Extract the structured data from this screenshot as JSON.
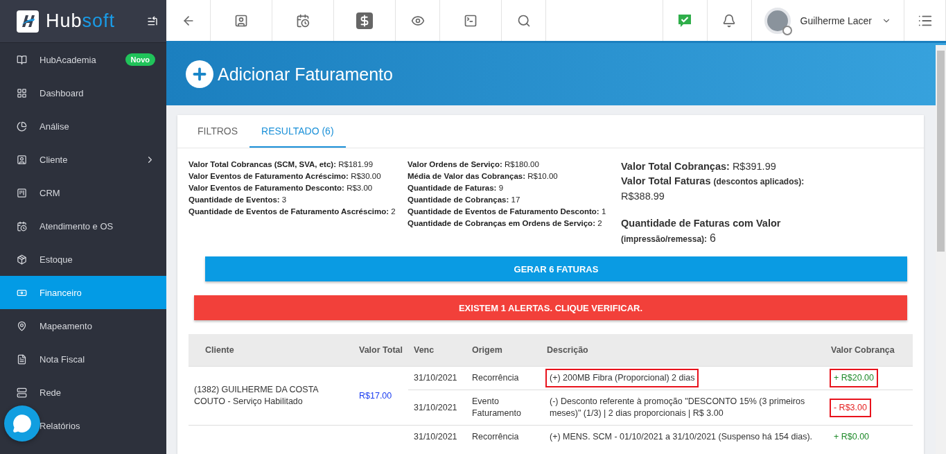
{
  "brand": {
    "name_part_1": "Hub",
    "name_part_2": "soft"
  },
  "sidebar": {
    "items": [
      {
        "label": "HubAcademia",
        "badge": "Novo",
        "selected": false
      },
      {
        "label": "Dashboard",
        "selected": false
      },
      {
        "label": "Análise",
        "selected": false
      },
      {
        "label": "Cliente",
        "selected": false,
        "has_submenu": true
      },
      {
        "label": "CRM",
        "selected": false
      },
      {
        "label": "Atendimento e OS",
        "selected": false
      },
      {
        "label": "Estoque",
        "selected": false
      },
      {
        "label": "Financeiro",
        "selected": true
      },
      {
        "label": "Mapeamento",
        "selected": false
      },
      {
        "label": "Nota Fiscal",
        "selected": false
      },
      {
        "label": "Rede",
        "selected": false
      },
      {
        "label": "Relatórios",
        "selected": false
      }
    ]
  },
  "topbar": {
    "user": "Guilherme Lacer"
  },
  "page": {
    "title": "Adicionar Faturamento"
  },
  "tabs": [
    {
      "label": "FILTROS",
      "selected": false
    },
    {
      "label": "RESULTADO (6)",
      "selected": true
    }
  ],
  "stats_left": [
    {
      "label": "Valor Total Cobrancas (SCM, SVA, etc):",
      "value": "R$181.99"
    },
    {
      "label": "Valor Eventos de Faturamento Acréscimo:",
      "value": "R$30.00"
    },
    {
      "label": "Valor Eventos de Faturamento Desconto:",
      "value": "R$3.00"
    },
    {
      "label": "Quantidade de Eventos:",
      "value": "3"
    },
    {
      "label": "Quantidade de Eventos de Faturamento Ascréscimo:",
      "value": "2"
    }
  ],
  "stats_middle": [
    {
      "label": "Valor Ordens de Serviço:",
      "value": "R$180.00"
    },
    {
      "label": "Média de Valor das Cobranças:",
      "value": "R$10.00"
    },
    {
      "label": "Quantidade de Faturas:",
      "value": "9"
    },
    {
      "label": "Quantidade de Cobranças:",
      "value": "17"
    },
    {
      "label": "Quantidade de Eventos de Faturamento Desconto:",
      "value": "1"
    },
    {
      "label": "Quantidade de Cobranças em Ordens de Serviço:",
      "value": "2"
    }
  ],
  "summary": [
    {
      "label": "Valor Total Cobranças:",
      "value": "R$391.99"
    },
    {
      "label": "Valor Total Faturas",
      "note": "(descontos aplicados):",
      "value": "R$388.99"
    },
    {
      "label": "Quantidade de Faturas com Valor",
      "note": "(impressão/remessa):",
      "value": "6"
    }
  ],
  "generate_button": "GERAR 6 FATURAS",
  "alert_button": "EXISTEM 1 ALERTAS. CLIQUE VERIFICAR.",
  "table": {
    "columns": [
      "Cliente",
      "Valor Total",
      "Venc",
      "Origem",
      "Descrição",
      "Valor Cobrança"
    ],
    "rows": [
      {
        "client": "(1382) GUILHERME DA COSTA COUTO - Serviço Habilitado",
        "total": "R$17.00",
        "charges": [
          {
            "due": "31/10/2021",
            "origin": "Recorrência",
            "description": "(+) 200MB Fibra (Proporcional) 2 dias",
            "value": "+ R$20.00",
            "kind": "plus",
            "description_highlighted": true,
            "value_highlighted": true
          },
          {
            "due": "31/10/2021",
            "origin": "Evento Faturamento",
            "description": "(-) Desconto referente à promoção \"DESCONTO 15% (3 primeiros meses)\" (1/3) | 2 dias proporcionais | R$ 3.00",
            "value": "- R$3.00",
            "kind": "minus",
            "description_highlighted": false,
            "value_highlighted": true
          }
        ]
      },
      {
        "charges": [
          {
            "due": "31/10/2021",
            "origin": "Recorrência",
            "description": "(+) MENS. SCM - 01/10/2021 a 31/10/2021 (Suspenso há 154 dias).",
            "value": "+ R$0.00",
            "kind": "plus",
            "description_highlighted": false,
            "value_highlighted": false
          }
        ]
      }
    ]
  }
}
